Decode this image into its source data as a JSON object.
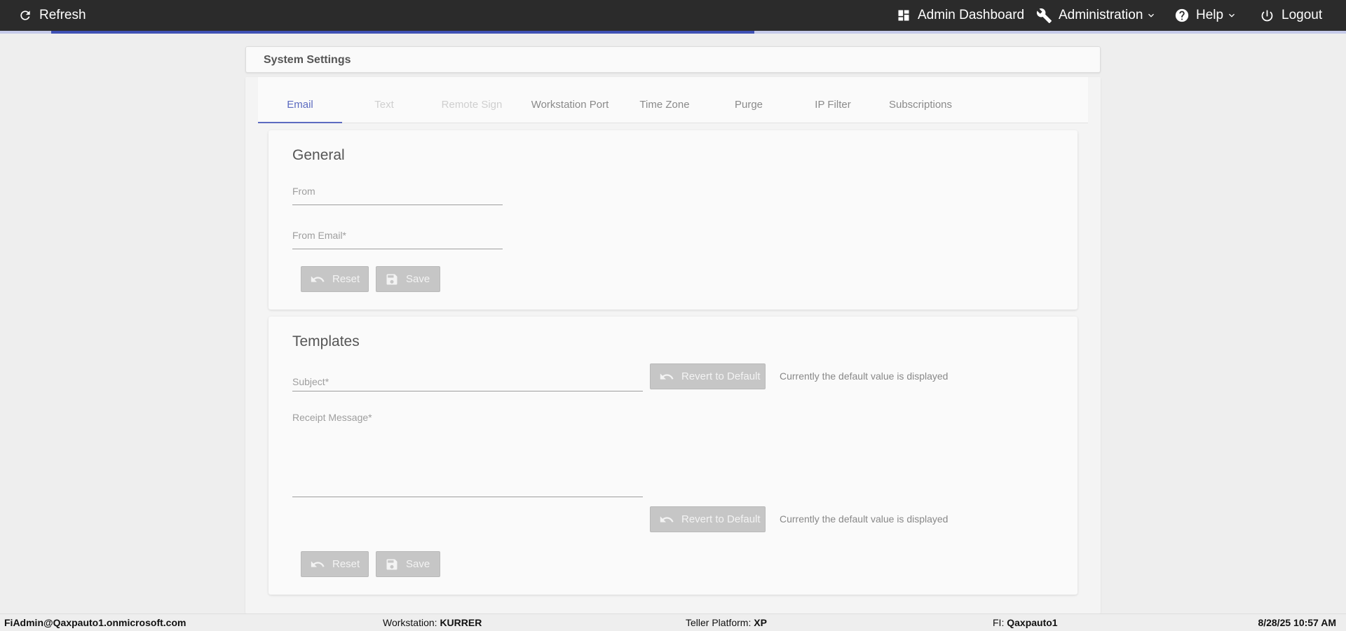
{
  "topbar": {
    "refresh_label": "Refresh",
    "admin_dashboard_label": "Admin Dashboard",
    "administration_label": "Administration",
    "help_label": "Help",
    "logout_label": "Logout"
  },
  "page": {
    "title": "System Settings"
  },
  "tabs": [
    {
      "label": "Email",
      "state": "active"
    },
    {
      "label": "Text",
      "state": "disabled"
    },
    {
      "label": "Remote Sign",
      "state": "disabled"
    },
    {
      "label": "Workstation Port",
      "state": "normal"
    },
    {
      "label": "Time Zone",
      "state": "normal"
    },
    {
      "label": "Purge",
      "state": "normal"
    },
    {
      "label": "IP Filter",
      "state": "normal"
    },
    {
      "label": "Subscriptions",
      "state": "normal"
    }
  ],
  "general": {
    "heading": "General",
    "from_label": "From",
    "from_email_label": "From Email*",
    "reset_label": "Reset",
    "save_label": "Save"
  },
  "templates": {
    "heading": "Templates",
    "subject_label": "Subject*",
    "receipt_label": "Receipt Message*",
    "revert_label": "Revert to Default",
    "default_note": "Currently the default value is displayed",
    "reset_label": "Reset",
    "save_label": "Save"
  },
  "status": {
    "user": "FiAdmin@Qaxpauto1.onmicrosoft.com",
    "workstation_label": "Workstation:",
    "workstation_value": "KURRER",
    "platform_label": "Teller Platform:",
    "platform_value": "XP",
    "fi_label": "FI:",
    "fi_value": "Qaxpauto1",
    "datetime": "8/28/25 10:57 AM"
  },
  "colors": {
    "accent": "#5c6bc0",
    "progress": "#3f51b5",
    "topbar": "#2b2b2b"
  },
  "progress_fraction": 0.52
}
